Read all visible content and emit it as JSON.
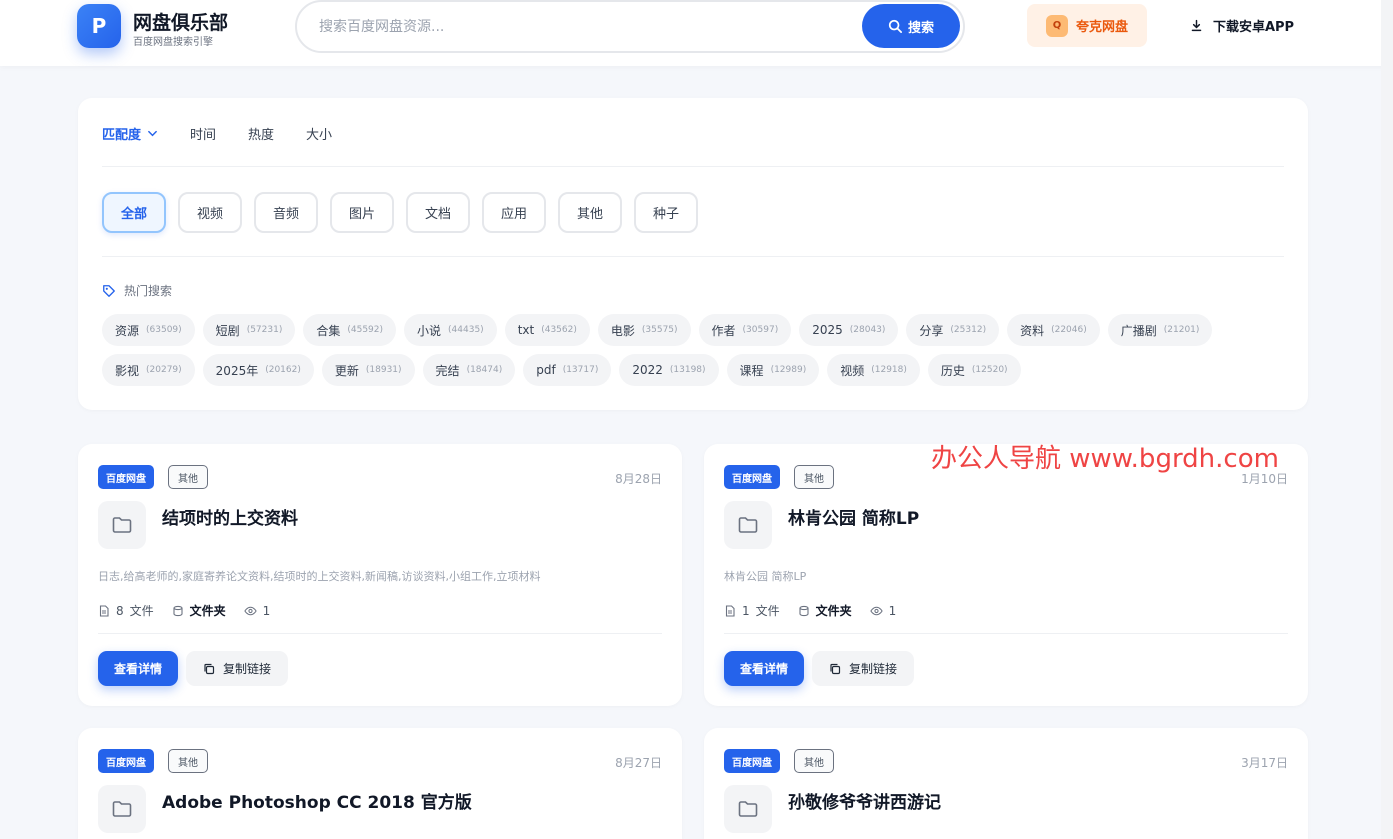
{
  "header": {
    "logo_letter": "P",
    "title": "网盘俱乐部",
    "subtitle": "百度网盘搜索引擎",
    "search_placeholder": "搜索百度网盘资源...",
    "search_button": "搜索",
    "quark_label": "夸克网盘",
    "quark_icon_letter": "Q",
    "download_label": "下载安卓APP"
  },
  "sort": {
    "items": [
      "匹配度",
      "时间",
      "热度",
      "大小"
    ],
    "active": "匹配度"
  },
  "types": {
    "items": [
      "全部",
      "视频",
      "音频",
      "图片",
      "文档",
      "应用",
      "其他",
      "种子"
    ],
    "active": "全部"
  },
  "hot": {
    "label": "热门搜索",
    "tags": [
      {
        "name": "资源",
        "count": "(63509)"
      },
      {
        "name": "短剧",
        "count": "(57231)"
      },
      {
        "name": "合集",
        "count": "(45592)"
      },
      {
        "name": "小说",
        "count": "(44435)"
      },
      {
        "name": "txt",
        "count": "(43562)"
      },
      {
        "name": "电影",
        "count": "(35575)"
      },
      {
        "name": "作者",
        "count": "(30597)"
      },
      {
        "name": "2025",
        "count": "(28043)"
      },
      {
        "name": "分享",
        "count": "(25312)"
      },
      {
        "name": "资料",
        "count": "(22046)"
      },
      {
        "name": "广播剧",
        "count": "(21201)"
      },
      {
        "name": "影视",
        "count": "(20279)"
      },
      {
        "name": "2025年",
        "count": "(20162)"
      },
      {
        "name": "更新",
        "count": "(18931)"
      },
      {
        "name": "完结",
        "count": "(18474)"
      },
      {
        "name": "pdf",
        "count": "(13717)"
      },
      {
        "name": "2022",
        "count": "(13198)"
      },
      {
        "name": "课程",
        "count": "(12989)"
      },
      {
        "name": "视频",
        "count": "(12918)"
      },
      {
        "name": "历史",
        "count": "(12520)"
      }
    ]
  },
  "cards": [
    {
      "pan": "百度网盘",
      "type": "其他",
      "date": "8月28日",
      "title": "结项时的上交资料",
      "desc": "日志,给高老师的,家庭寄养论文资料,结项时的上交资料,新闻稿,访谈资料,小组工作,立项材料",
      "files": "8",
      "files_unit": "文件",
      "kind": "文件夹",
      "views": "1",
      "detail": "查看详情",
      "copy": "复制链接"
    },
    {
      "pan": "百度网盘",
      "type": "其他",
      "date": "1月10日",
      "title": "林肯公园 简称LP",
      "desc": "林肯公园 简称LP",
      "files": "1",
      "files_unit": "文件",
      "kind": "文件夹",
      "views": "1",
      "detail": "查看详情",
      "copy": "复制链接"
    },
    {
      "pan": "百度网盘",
      "type": "其他",
      "date": "8月27日",
      "title": "Adobe Photoshop CC 2018 官方版"
    },
    {
      "pan": "百度网盘",
      "type": "其他",
      "date": "3月17日",
      "title": "孙敬修爷爷讲西游记"
    }
  ],
  "watermark": "办公人导航  www.bgrdh.com",
  "colors": {
    "accent": "#2563eb",
    "quark": "#ea580c",
    "watermark": "#ef4444"
  }
}
